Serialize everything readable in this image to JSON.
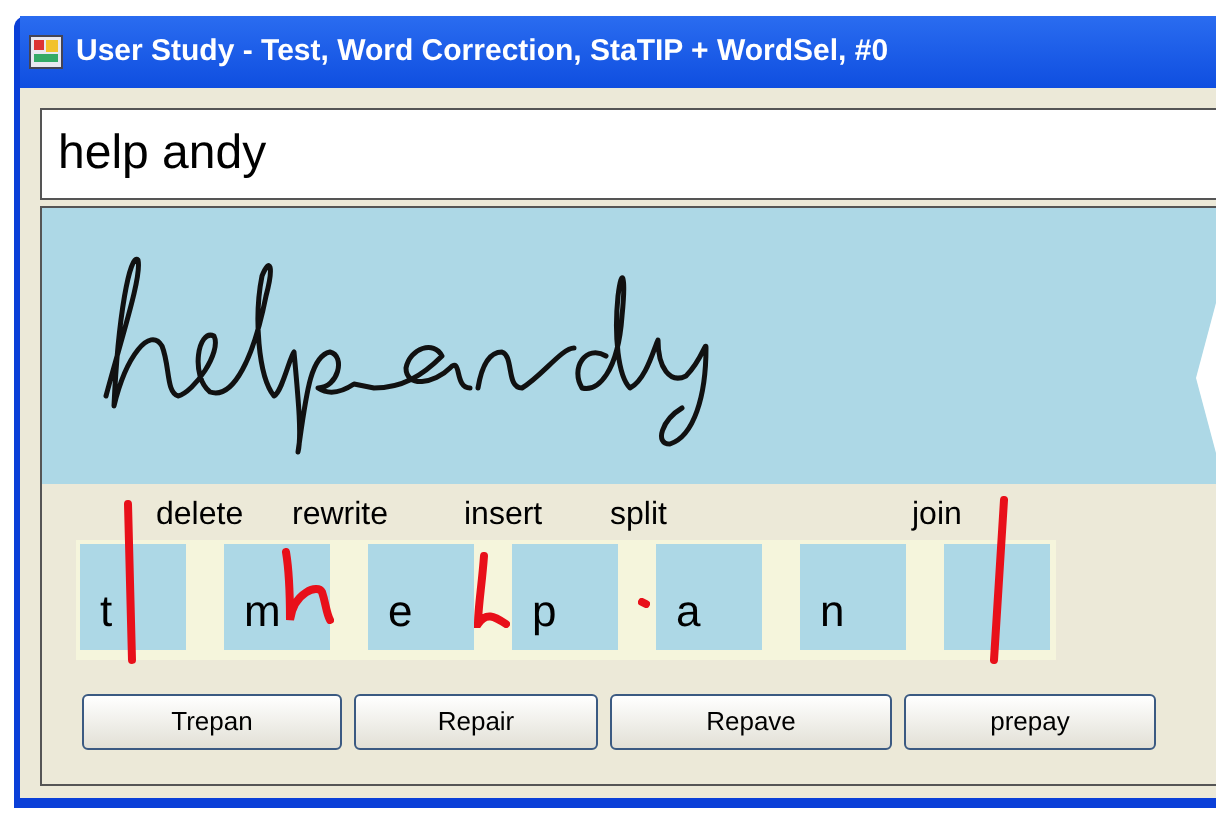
{
  "window": {
    "title": "User Study - Test, Word Correction, StaTIP + WordSel, #0"
  },
  "text_field": {
    "value": "help andy"
  },
  "gesture_labels": [
    "delete",
    "rewrite",
    "insert",
    "split",
    "join"
  ],
  "tiles": [
    {
      "kind": "letter",
      "letter": "t"
    },
    {
      "kind": "letter",
      "letter": "m"
    },
    {
      "kind": "letter",
      "letter": "e"
    },
    {
      "kind": "letter",
      "letter": "p"
    },
    {
      "kind": "letter",
      "letter": "a"
    },
    {
      "kind": "letter",
      "letter": "n"
    },
    {
      "kind": "blank"
    }
  ],
  "buttons": [
    "Trepan",
    "Repair",
    "Repave",
    "prepay"
  ]
}
